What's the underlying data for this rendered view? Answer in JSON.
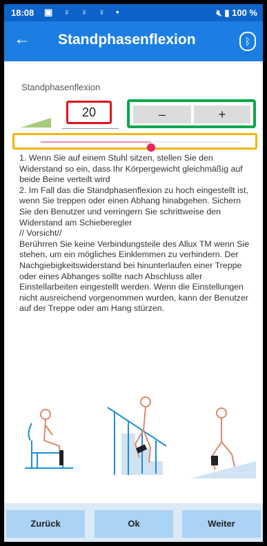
{
  "status_bar": {
    "time": "18:08",
    "battery": "100 %",
    "mute_icon": "mute-icon",
    "battery_icon": "battery-icon"
  },
  "app_bar": {
    "title": "Standphasenflexion",
    "back_icon": "arrow-left-icon",
    "bluetooth_icon": "bluetooth-icon"
  },
  "setting": {
    "label": "Standphasenflexion",
    "value": "20",
    "minus_label": "–",
    "plus_label": "+",
    "slider_level": 0.55
  },
  "instructions": [
    "1. Wenn Sie auf einem Stuhl sitzen, stellen Sie den Widerstand so ein, dass Ihr Körpergewicht gleichmäßig auf beide Beine verteilt wird",
    "2. Im Fall das die Standphasenflexion zu hoch eingestellt ist, wenn Sie treppen oder einen Abhang hinabgehen. Sichern Sie den Benutzer und verringern Sie schrittweise den Widerstand am Schieberegler",
    "// Vorsicht//",
    "Berührren Sie keine Verbindungsteile des Allux TM wenn Sie stehen, um ein mögliches Einklemmen zu verhindern. Der Nachgiebigkeitswiderstand bei hinunterlaufen einer Treppe oder eines Abhanges sollte nach Abschluss aller Einstellarbeiten eingestellt werden. Wenn die Einstellungen nicht ausreichend vorgenommen wurden, kann der Benutzer auf der Treppe oder am Hang stürzen."
  ],
  "buttons": {
    "back": "Zurück",
    "ok": "Ok",
    "next": "Weiter"
  },
  "colors": {
    "status_bar": "#0d63c9",
    "app_bar": "#1c7ee3",
    "value_highlight": "#e0101a",
    "stepper_highlight": "#0aa74a",
    "slider_highlight": "#f4b400",
    "button": "#aad3f5"
  }
}
